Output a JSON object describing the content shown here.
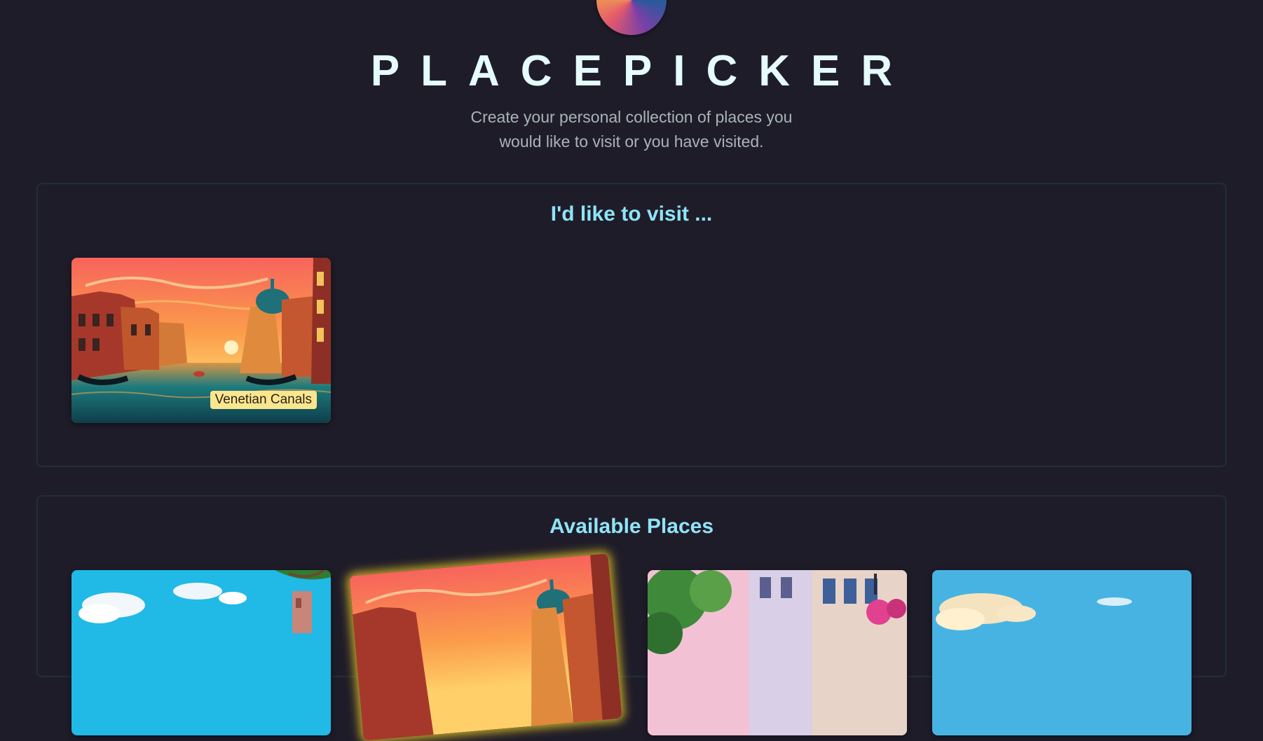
{
  "header": {
    "logo_icon": "globe-logo-icon",
    "title": "PLACEPICKER",
    "subtitle": "Create your personal collection of places you would like to visit or you have visited."
  },
  "visit_section": {
    "title": "I'd like to visit ...",
    "places": [
      {
        "title": "Venetian Canals"
      }
    ]
  },
  "available_section": {
    "title": "Available Places"
  },
  "colors": {
    "background": "#1f1c29",
    "title": "#e5fbfc",
    "section_heading": "#8fe4f6",
    "label_bg": "#fbe68f",
    "selected_glow": "#e6c828"
  }
}
